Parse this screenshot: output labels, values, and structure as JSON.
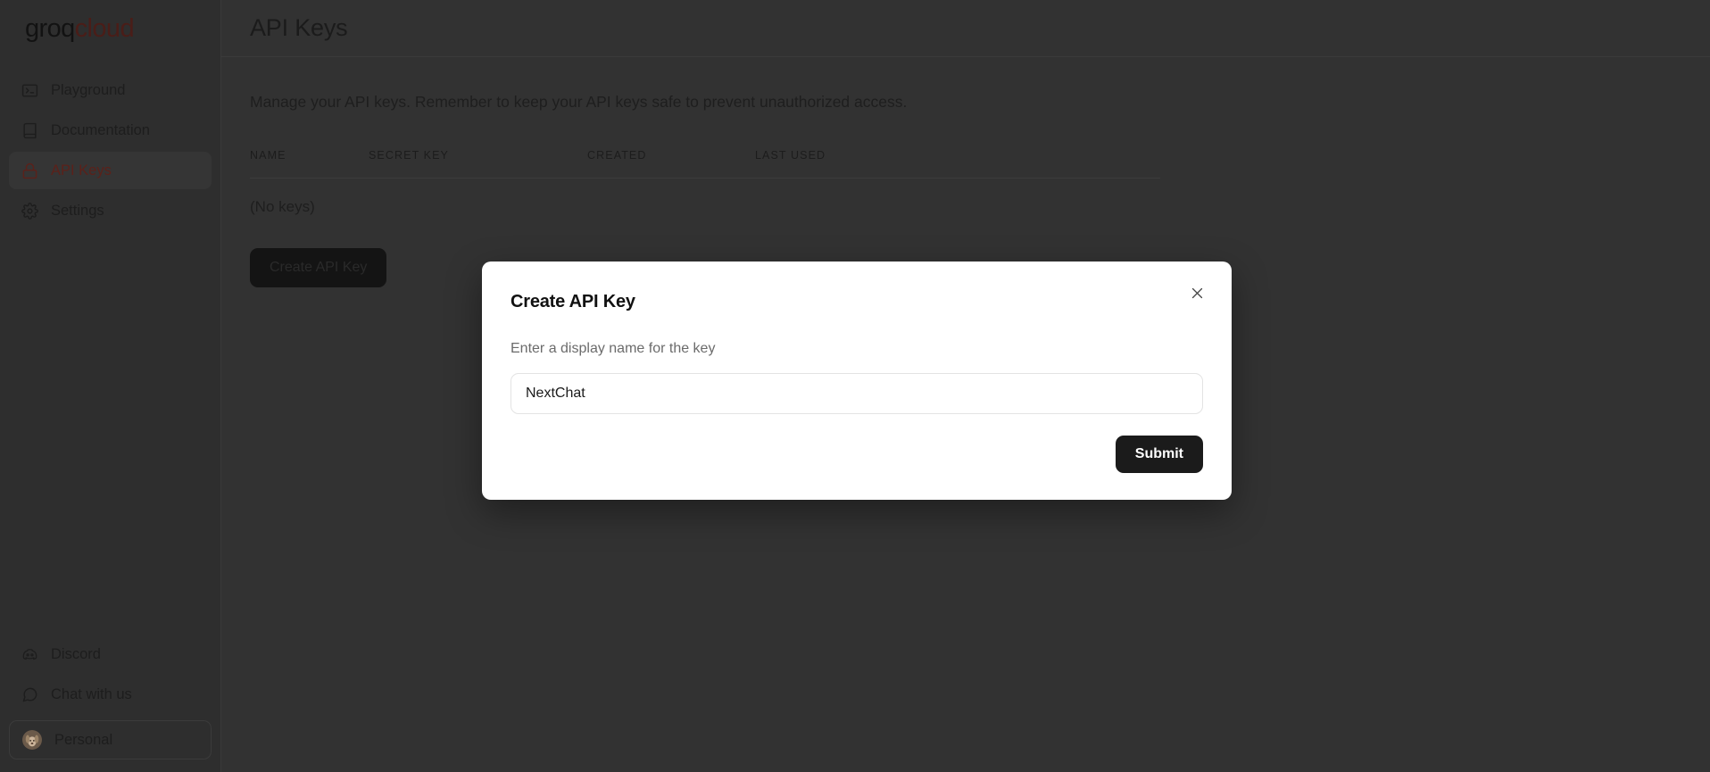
{
  "brand": {
    "logo_primary": "groq",
    "logo_secondary": "cloud",
    "primary_color": "#121212",
    "secondary_color": "#4a1d18"
  },
  "sidebar": {
    "items": [
      {
        "label": "Playground",
        "icon": "terminal-icon",
        "active": false
      },
      {
        "label": "Documentation",
        "icon": "book-icon",
        "active": false
      },
      {
        "label": "API Keys",
        "icon": "lock-icon",
        "active": true
      },
      {
        "label": "Settings",
        "icon": "gear-icon",
        "active": false
      }
    ],
    "bottom_items": [
      {
        "label": "Discord",
        "icon": "discord-icon"
      },
      {
        "label": "Chat with us",
        "icon": "chat-bubble-icon"
      }
    ],
    "account": {
      "label": "Personal",
      "avatar": "dog-avatar"
    }
  },
  "header": {
    "title": "API Keys"
  },
  "main": {
    "description": "Manage your API keys. Remember to keep your API keys safe to prevent unauthorized access.",
    "table": {
      "columns": [
        "NAME",
        "SECRET KEY",
        "CREATED",
        "LAST USED"
      ],
      "empty_text": "(No keys)",
      "rows": []
    },
    "create_button_label": "Create API Key"
  },
  "modal": {
    "title": "Create API Key",
    "close_icon": "close-icon",
    "field_label": "Enter a display name for the key",
    "input_value": "NextChat",
    "input_placeholder": "",
    "submit_label": "Submit"
  }
}
